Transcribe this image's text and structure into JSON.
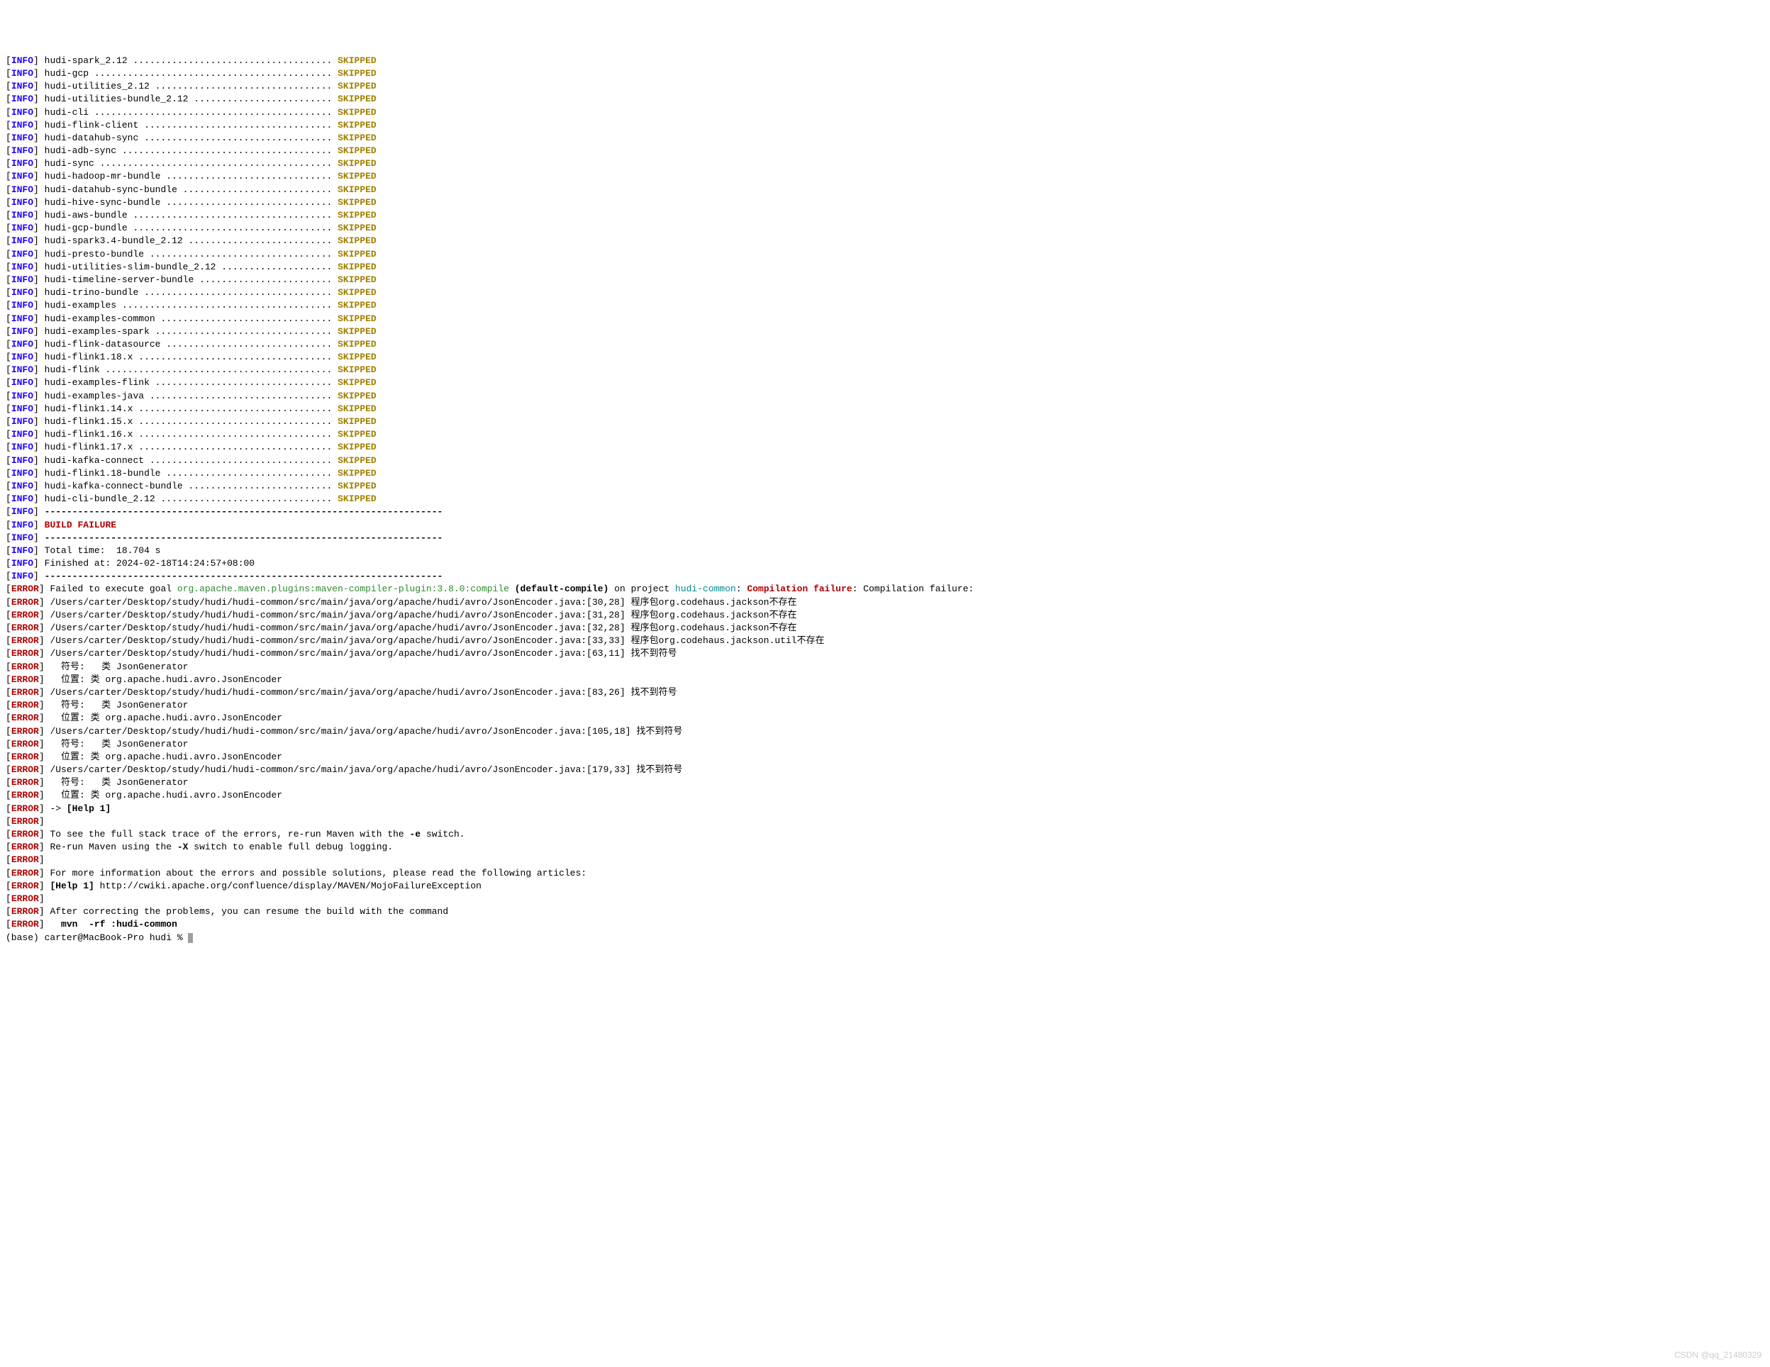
{
  "skipped": [
    "hudi-spark_2.12 ....................................",
    "hudi-gcp ...........................................",
    "hudi-utilities_2.12 ................................",
    "hudi-utilities-bundle_2.12 .........................",
    "hudi-cli ...........................................",
    "hudi-flink-client ..................................",
    "hudi-datahub-sync ..................................",
    "hudi-adb-sync ......................................",
    "hudi-sync ..........................................",
    "hudi-hadoop-mr-bundle ..............................",
    "hudi-datahub-sync-bundle ...........................",
    "hudi-hive-sync-bundle ..............................",
    "hudi-aws-bundle ....................................",
    "hudi-gcp-bundle ....................................",
    "hudi-spark3.4-bundle_2.12 ..........................",
    "hudi-presto-bundle .................................",
    "hudi-utilities-slim-bundle_2.12 ....................",
    "hudi-timeline-server-bundle ........................",
    "hudi-trino-bundle ..................................",
    "hudi-examples ......................................",
    "hudi-examples-common ...............................",
    "hudi-examples-spark ................................",
    "hudi-flink-datasource ..............................",
    "hudi-flink1.18.x ...................................",
    "hudi-flink .........................................",
    "hudi-examples-flink ................................",
    "hudi-examples-java .................................",
    "hudi-flink1.14.x ...................................",
    "hudi-flink1.15.x ...................................",
    "hudi-flink1.16.x ...................................",
    "hudi-flink1.17.x ...................................",
    "hudi-kafka-connect .................................",
    "hudi-flink1.18-bundle ..............................",
    "hudi-kafka-connect-bundle ..........................",
    "hudi-cli-bundle_2.12 ..............................."
  ],
  "skip_label": "SKIPPED",
  "sep": "------------------------------------------------------------------------",
  "build_failure": "BUILD FAILURE",
  "total_time": "Total time:  18.704 s",
  "finished_at": "Finished at: 2024-02-18T14:24:57+08:00",
  "fail_prefix": "Failed to execute goal ",
  "goal": "org.apache.maven.plugins:maven-compiler-plugin:3.8.0:compile",
  "default_compile": " (default-compile)",
  "on_project": " on project ",
  "project": "hudi-common",
  "colon_space": ": ",
  "comp_fail": "Compilation failure",
  "comp_fail_tail": ": Compilation failure:",
  "err_lines": [
    "/Users/carter/Desktop/study/hudi/hudi-common/src/main/java/org/apache/hudi/avro/JsonEncoder.java:[30,28] 程序包org.codehaus.jackson不存在",
    "/Users/carter/Desktop/study/hudi/hudi-common/src/main/java/org/apache/hudi/avro/JsonEncoder.java:[31,28] 程序包org.codehaus.jackson不存在",
    "/Users/carter/Desktop/study/hudi/hudi-common/src/main/java/org/apache/hudi/avro/JsonEncoder.java:[32,28] 程序包org.codehaus.jackson不存在",
    "/Users/carter/Desktop/study/hudi/hudi-common/src/main/java/org/apache/hudi/avro/JsonEncoder.java:[33,33] 程序包org.codehaus.jackson.util不存在",
    "/Users/carter/Desktop/study/hudi/hudi-common/src/main/java/org/apache/hudi/avro/JsonEncoder.java:[63,11] 找不到符号",
    "  符号:   类 JsonGenerator",
    "  位置: 类 org.apache.hudi.avro.JsonEncoder",
    "/Users/carter/Desktop/study/hudi/hudi-common/src/main/java/org/apache/hudi/avro/JsonEncoder.java:[83,26] 找不到符号",
    "  符号:   类 JsonGenerator",
    "  位置: 类 org.apache.hudi.avro.JsonEncoder",
    "/Users/carter/Desktop/study/hudi/hudi-common/src/main/java/org/apache/hudi/avro/JsonEncoder.java:[105,18] 找不到符号",
    "  符号:   类 JsonGenerator",
    "  位置: 类 org.apache.hudi.avro.JsonEncoder",
    "/Users/carter/Desktop/study/hudi/hudi-common/src/main/java/org/apache/hudi/avro/JsonEncoder.java:[179,33] 找不到符号",
    "  符号:   类 JsonGenerator",
    "  位置: 类 org.apache.hudi.avro.JsonEncoder"
  ],
  "help_arrow": "-> ",
  "help1": "[Help 1]",
  "trace_msg": "To see the full stack trace of the errors, re-run Maven with the ",
  "e_switch": "-e",
  "switch_suffix": " switch.",
  "rerun_msg": "Re-run Maven using the ",
  "x_switch": "-X",
  "debug_suffix": " switch to enable full debug logging.",
  "more_info": "For more information about the errors and possible solutions, please read the following articles:",
  "help_url": " http://cwiki.apache.org/confluence/display/MAVEN/MojoFailureException",
  "after_correct": "After correcting the problems, you can resume the build with the command",
  "resume_cmd": "  mvn <args> -rf :hudi-common",
  "prompt": "(base) carter@MacBook-Pro hudi % ",
  "watermark": "CSDN @qq_21480329"
}
